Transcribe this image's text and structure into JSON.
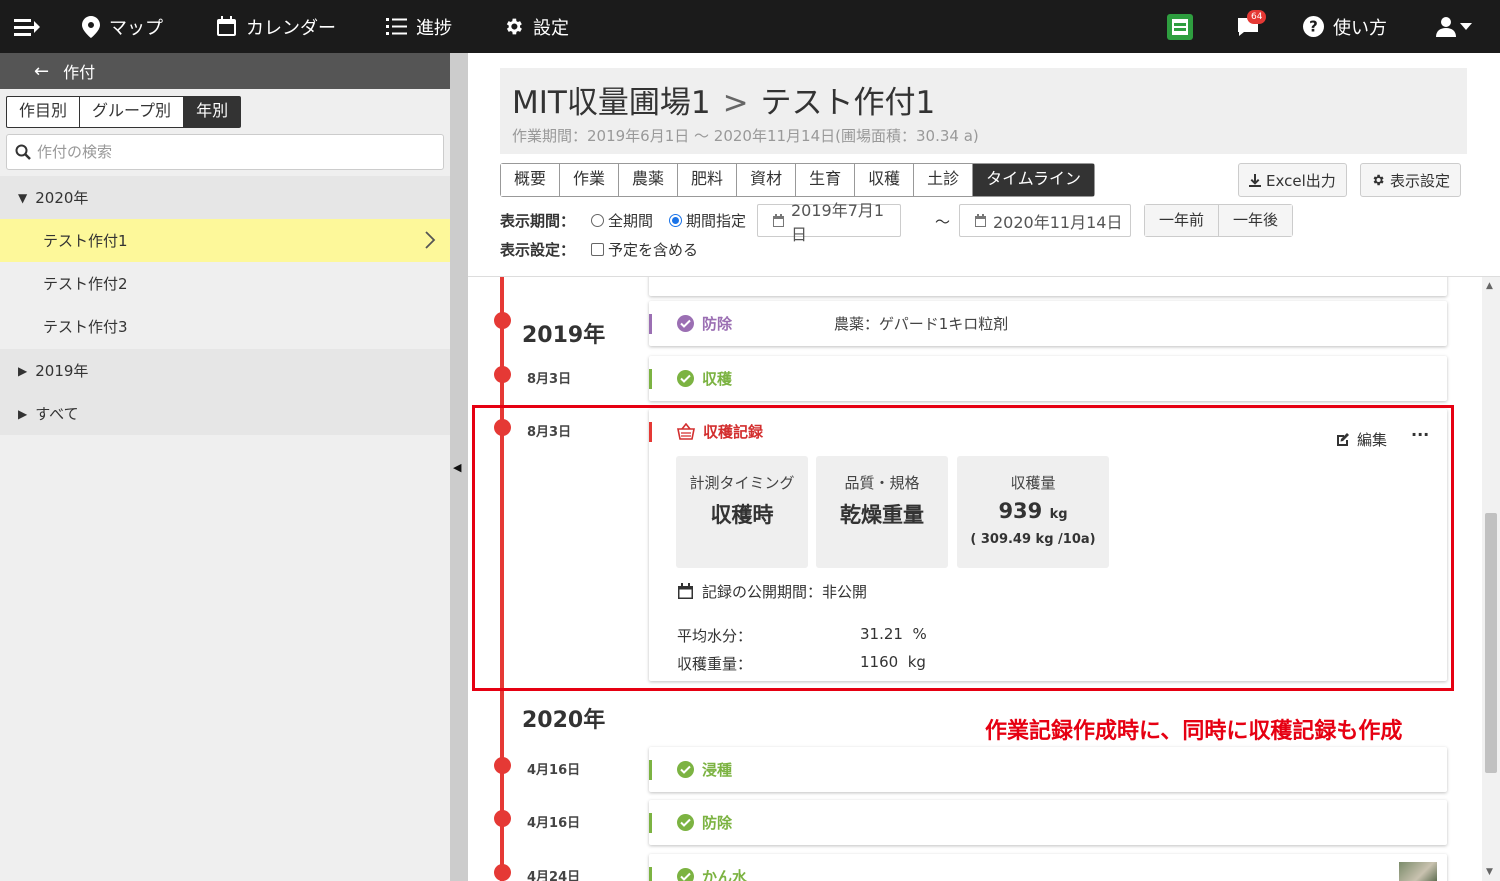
{
  "topbar": {
    "map_label": "マップ",
    "calendar_label": "カレンダー",
    "progress_label": "進捗",
    "settings_label": "設定",
    "notification_count": "64",
    "help_label": "使い方"
  },
  "sidebar": {
    "header_label": "作付",
    "segments": [
      "作目別",
      "グループ別",
      "年別"
    ],
    "search_placeholder": "作付の検索",
    "groups": [
      {
        "label": "2020年",
        "items": [
          "テスト作付1",
          "テスト作付2",
          "テスト作付3"
        ]
      },
      {
        "label": "2019年"
      },
      {
        "label": "すべて"
      }
    ]
  },
  "header": {
    "field": "MIT収量圃場1",
    "crop": "テスト作付1",
    "subtitle": "作業期間：2019年6月1日 ～ 2020年11月14日(圃場面積：30.34 a)"
  },
  "tabs": [
    "概要",
    "作業",
    "農薬",
    "肥料",
    "資材",
    "生育",
    "収穫",
    "土診",
    "タイムライン"
  ],
  "buttons": {
    "excel": "Excel出力",
    "display": "表示設定"
  },
  "filters": {
    "period_label": "表示期間：",
    "all_period": "全期間",
    "specified_period": "期間指定",
    "date_from": "2019年7月1日",
    "tilde": "～",
    "date_to": "2020年11月14日",
    "prev_year": "一年前",
    "next_year": "一年後",
    "display_label": "表示設定：",
    "include_plan": "予定を含める"
  },
  "timeline": {
    "year_2019": "2019年",
    "year_2020": "2020年",
    "entries": [
      {
        "date": "",
        "title": "防除",
        "detail": "農薬：ゲパード1キロ粒剤"
      },
      {
        "date": "8月3日",
        "title": "収穫"
      },
      {
        "date": "8月3日",
        "title": "収穫記録"
      },
      {
        "date": "4月16日",
        "title": "浸種"
      },
      {
        "date": "4月16日",
        "title": "防除"
      },
      {
        "date": "4月24日",
        "title": "かん水"
      }
    ],
    "record": {
      "edit_label": "編集",
      "more_label": "···",
      "timing_label": "計測タイミング",
      "timing_value": "収穫時",
      "quality_label": "品質・規格",
      "quality_value": "乾燥重量",
      "yield_label": "収穫量",
      "yield_value": "939",
      "yield_unit": "kg",
      "yield_per_area": "( 309.49 kg /10a)",
      "public_period": "記録の公開期間：非公開",
      "moisture_label": "平均水分：",
      "moisture_value": "31.21  %",
      "weight_label": "収穫重量：",
      "weight_value": "1160  kg"
    }
  },
  "annotation": "作業記録作成時に、同時に収穫記録も作成",
  "colors": {
    "accent": "#e53935",
    "work_green": "#7cb342",
    "pest_purple": "#9b6fb3",
    "annotation_red": "#e60012",
    "highlight_yellow": "#fdf89a"
  }
}
